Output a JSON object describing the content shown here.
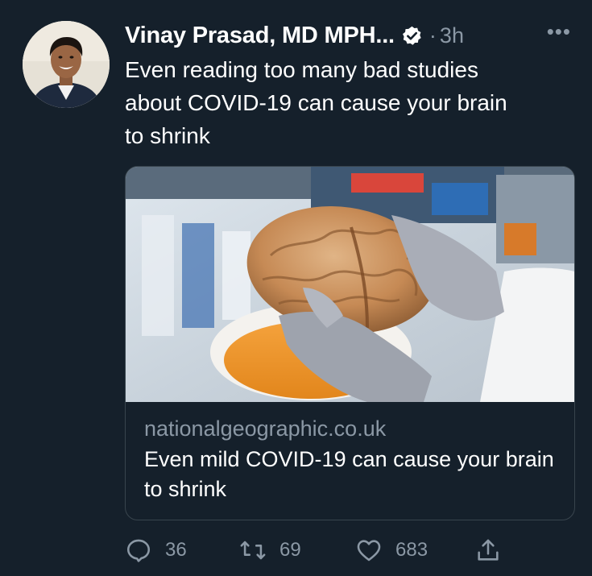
{
  "author": {
    "name": "Vinay Prasad, MD MPH...",
    "verified": true,
    "time_separator": "·",
    "time": "3h"
  },
  "more_label": "•••",
  "tweet": {
    "text": "Even reading too many bad studies\nabout COVID-19 can cause your brain\nto shrink"
  },
  "card": {
    "domain": "nationalgeographic.co.uk",
    "title": "Even mild COVID-19 can cause your brain to shrink"
  },
  "actions": {
    "replies": "36",
    "retweets": "69",
    "likes": "683"
  },
  "colors": {
    "background": "#15202b",
    "secondary_text": "#8b98a5",
    "border": "#38444d"
  },
  "icons": [
    "verified-badge-icon",
    "more-icon",
    "reply-icon",
    "retweet-icon",
    "like-icon",
    "share-icon"
  ]
}
